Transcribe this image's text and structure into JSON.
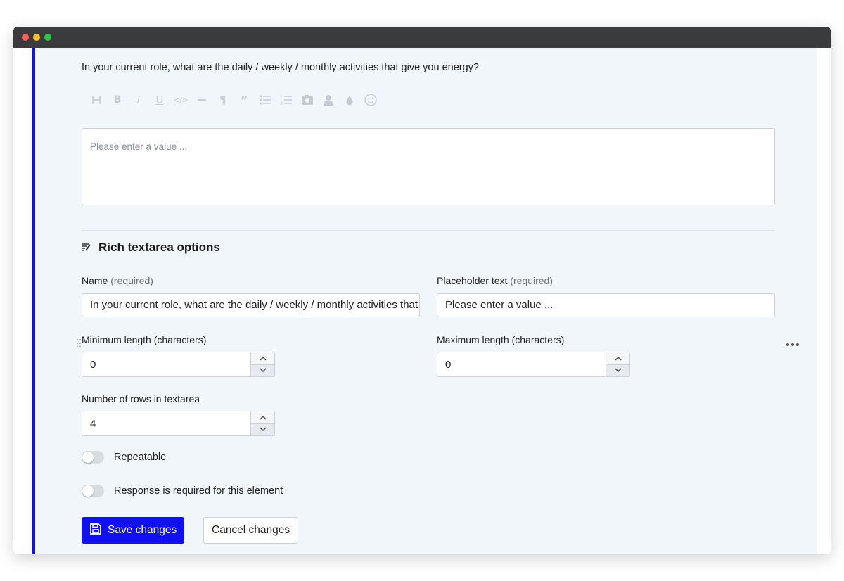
{
  "question": {
    "text": "In your current role, what are the daily / weekly / monthly activities that give you energy?"
  },
  "toolbar": {
    "items": [
      {
        "icon": "heading-icon",
        "glyph": "H"
      },
      {
        "icon": "bold-icon",
        "glyph": "B"
      },
      {
        "icon": "italic-icon",
        "glyph": "I"
      },
      {
        "icon": "underline-icon",
        "glyph": "U"
      },
      {
        "icon": "code-icon",
        "glyph": "</>"
      },
      {
        "icon": "horizontal-rule-icon",
        "glyph": "—"
      },
      {
        "icon": "paragraph-icon",
        "glyph": "¶"
      },
      {
        "icon": "quote-icon",
        "glyph": "99"
      },
      {
        "icon": "bullet-list-icon",
        "glyph": "☰"
      },
      {
        "icon": "numbered-list-icon",
        "glyph": "1≡"
      },
      {
        "icon": "image-icon",
        "glyph": "▣"
      },
      {
        "icon": "user-icon",
        "glyph": "●"
      },
      {
        "icon": "color-drop-icon",
        "glyph": "●"
      },
      {
        "icon": "emoji-icon",
        "glyph": "☺"
      }
    ]
  },
  "preview": {
    "placeholder": "Please enter a value ..."
  },
  "options": {
    "title": "Rich textarea options",
    "name_label": "Name",
    "name_required": "(required)",
    "name_value": "In your current role, what are the daily / weekly / monthly activities that give you energy?",
    "placeholder_label": "Placeholder text",
    "placeholder_required": "(required)",
    "placeholder_value": "Please enter a value ...",
    "min_label": "Minimum length (characters)",
    "min_value": "0",
    "max_label": "Maximum length (characters)",
    "max_value": "0",
    "rows_label": "Number of rows in textarea",
    "rows_value": "4",
    "repeatable_label": "Repeatable",
    "required_label": "Response is required for this element"
  },
  "actions": {
    "save_label": "Save changes",
    "cancel_label": "Cancel changes"
  },
  "colors": {
    "accent": "#1010f0",
    "panel_bg": "#f1f6fa"
  }
}
